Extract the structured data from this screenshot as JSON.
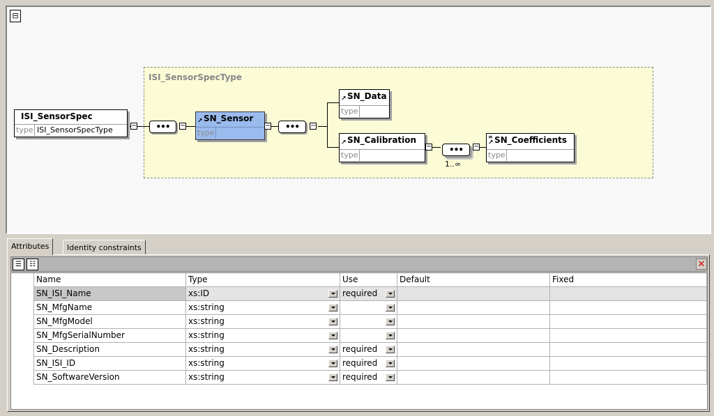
{
  "diagram": {
    "type_region_label": "ISI_SensorSpecType",
    "type_key": "type",
    "root": {
      "name": "ISI_SensorSpec",
      "type": "ISI_SensorSpecType"
    },
    "sensor": {
      "name": "SN_Sensor",
      "type": ""
    },
    "data": {
      "name": "SN_Data",
      "type": ""
    },
    "calibration": {
      "name": "SN_Calibration",
      "type": ""
    },
    "coefficients": {
      "name": "SN_Coefficients",
      "type": ""
    },
    "occurrence": "1..∞",
    "sequence_glyph": "•••",
    "expander_glyph": "−"
  },
  "tabs": [
    "Attributes",
    "Identity constraints"
  ],
  "toolbar": {
    "delete_glyph": "✕"
  },
  "table": {
    "columns": [
      "Name",
      "Type",
      "Use",
      "Default",
      "Fixed"
    ],
    "rows": [
      {
        "name": "SN_ISI_Name",
        "type": "xs:ID",
        "use": "required",
        "default": "",
        "fixed": ""
      },
      {
        "name": "SN_MfgName",
        "type": "xs:string",
        "use": "",
        "default": "",
        "fixed": ""
      },
      {
        "name": "SN_MfgModel",
        "type": "xs:string",
        "use": "",
        "default": "",
        "fixed": ""
      },
      {
        "name": "SN_MfgSerialNumber",
        "type": "xs:string",
        "use": "",
        "default": "",
        "fixed": ""
      },
      {
        "name": "SN_Description",
        "type": "xs:string",
        "use": "required",
        "default": "",
        "fixed": ""
      },
      {
        "name": "SN_ISI_ID",
        "type": "xs:string",
        "use": "required",
        "default": "",
        "fixed": ""
      },
      {
        "name": "SN_SoftwareVersion",
        "type": "xs:string",
        "use": "required",
        "default": "",
        "fixed": ""
      }
    ]
  }
}
